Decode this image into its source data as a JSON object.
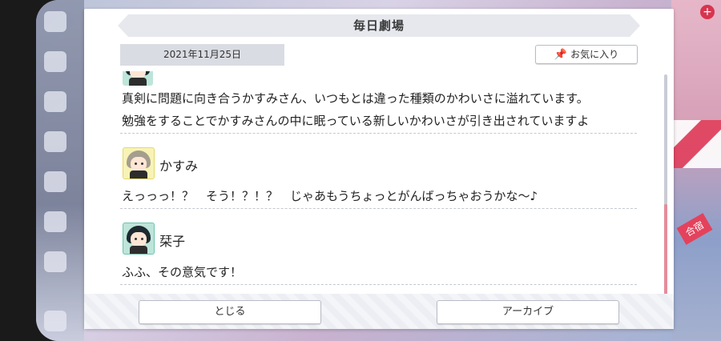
{
  "dialog": {
    "title": "毎日劇場",
    "date": "2021年11月25日",
    "favorite_label": "お気に入り"
  },
  "messages": {
    "intro_line1": "真剣に問題に向き合うかすみさん、いつもとは違った種類のかわいさに溢れています。",
    "intro_line2": "勉強をすることでかすみさんの中に眠っている新しいかわいさが引き出されていますよ",
    "kasumi": {
      "name": "かすみ",
      "text": "えっっっ！？　そう！？！？　じゃあもうちょっとがんばっちゃおうかな～♪"
    },
    "shioriko": {
      "name": "栞子",
      "text": "ふふ、その意気です！"
    }
  },
  "footer": {
    "close_label": "とじる",
    "archive_label": "アーカイブ"
  },
  "background": {
    "right_label": "合宿"
  },
  "colors": {
    "accent": "#e58c9c",
    "title_bg": "#e6e8ee"
  }
}
